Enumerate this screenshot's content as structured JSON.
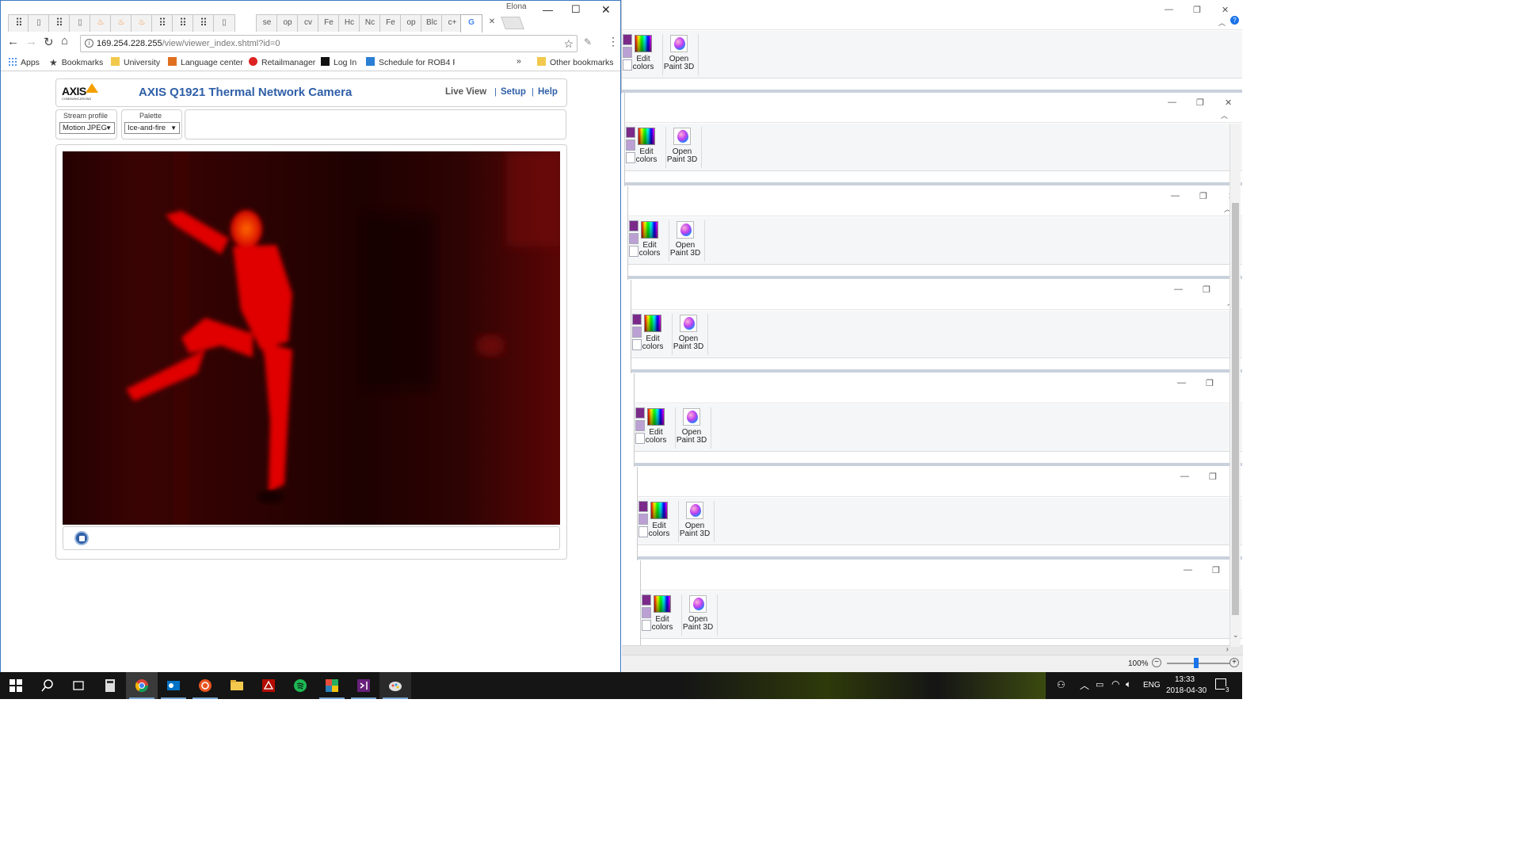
{
  "chrome": {
    "profile_name": "Elona",
    "tabs": [
      "",
      "",
      "",
      "",
      "",
      "",
      "",
      "",
      "",
      "",
      "",
      "se",
      "op",
      "cv",
      "Fe",
      "Hc",
      "Nc",
      "Fe",
      "op",
      "Blc",
      "c+",
      "G",
      ""
    ],
    "url_host": "169.254.228.255",
    "url_path": "/view/viewer_index.shtml?id=0",
    "window_controls": {
      "minimize": "—",
      "maximize": "☐",
      "close": "✕"
    },
    "bookmarks": [
      "Apps",
      "Bookmarks",
      "University",
      "Language center",
      "Retailmanager",
      "Log In",
      "Schedule for ROB4 F"
    ],
    "bookmarks_overflow": "»",
    "other_bookmarks": "Other bookmarks"
  },
  "axis": {
    "logo": "AXIS",
    "logo_sub": "COMMUNICATIONS",
    "title": "AXIS Q1921 Thermal Network Camera",
    "nav": {
      "live_view": "Live View",
      "sep1": "|",
      "setup": "Setup",
      "sep2": "|",
      "help": "Help"
    },
    "stream_profile_label": "Stream profile",
    "stream_profile_value": "Motion JPEG",
    "palette_label": "Palette",
    "palette_value": "Ice-and-fire"
  },
  "paint": {
    "edit_colors_l1": "Edit",
    "edit_colors_l2": "colors",
    "open_paint3d_l1": "Open",
    "open_paint3d_l2": "Paint 3D",
    "zoom": "100%"
  },
  "taskbar": {
    "language": "ENG",
    "time": "13:33",
    "date": "2018-04-30",
    "notification_count": "3"
  },
  "colors": {
    "accent": "#2f5fa8",
    "chrome_frame": "#3a78c2",
    "taskbar": "#151515"
  }
}
